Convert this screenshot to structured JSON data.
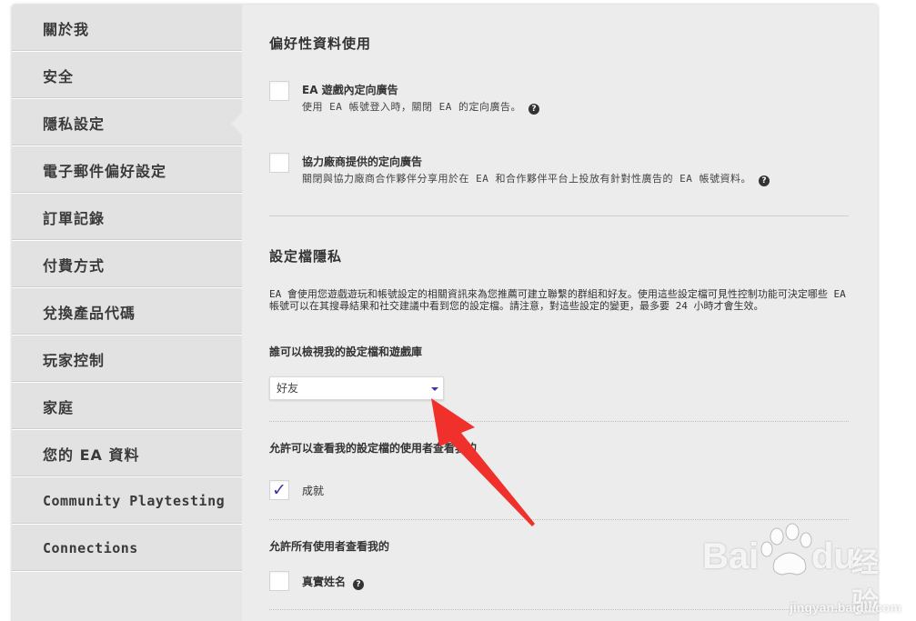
{
  "sidebar": {
    "items": [
      {
        "label": "關於我",
        "active": false
      },
      {
        "label": "安全",
        "active": false
      },
      {
        "label": "隱私設定",
        "active": true
      },
      {
        "label": "電子郵件偏好設定",
        "active": false
      },
      {
        "label": "訂單記錄",
        "active": false
      },
      {
        "label": "付費方式",
        "active": false
      },
      {
        "label": "兌換產品代碼",
        "active": false
      },
      {
        "label": "玩家控制",
        "active": false
      },
      {
        "label": "家庭",
        "active": false
      },
      {
        "label": "您的 EA 資料",
        "active": false
      },
      {
        "label": "Community Playtesting",
        "active": false
      },
      {
        "label": "Connections",
        "active": false
      }
    ]
  },
  "preference": {
    "title": "偏好性資料使用",
    "options": [
      {
        "title": "EA 遊戲內定向廣告",
        "desc": "使用 EA 帳號登入時，關閉 EA 的定向廣告。",
        "checked": false
      },
      {
        "title": "協力廠商提供的定向廣告",
        "desc": "關閉與協力廠商合作夥伴分享用於在 EA 和合作夥伴平台上投放有針對性廣告的 EA 帳號資料。",
        "checked": false
      }
    ]
  },
  "profile_privacy": {
    "title": "設定檔隱私",
    "description": "EA 會使用您遊戲遊玩和帳號設定的相關資訊來為您推薦可建立聯繫的群組和好友。使用這些設定檔可見性控制功能可決定哪些 EA 帳號可以在其搜尋結果和社交建議中看到您的設定檔。請注意，對這些設定的變更，最多要 24 小時才會生效。",
    "who_can_view_label": "誰可以檢視我的設定檔和遊戲庫",
    "who_can_view_value": "好友",
    "profile_viewers_label": "允許可以查看我的設定檔的使用者查看我的",
    "achievements": {
      "label": "成就",
      "checked": true
    },
    "all_users_label": "允許所有使用者查看我的",
    "real_name": {
      "label": "真實姓名",
      "checked": false
    }
  },
  "watermark": {
    "brand": "Bai",
    "brand2": "du",
    "brand_cn": "经验",
    "url": "jingyan.baidu.com"
  },
  "colors": {
    "accent": "#4b2ca8",
    "annotation_arrow": "#f0302a"
  },
  "icons": {
    "help": "question-circle-icon",
    "dropdown": "caret-down-icon",
    "check": "checkmark-icon"
  }
}
